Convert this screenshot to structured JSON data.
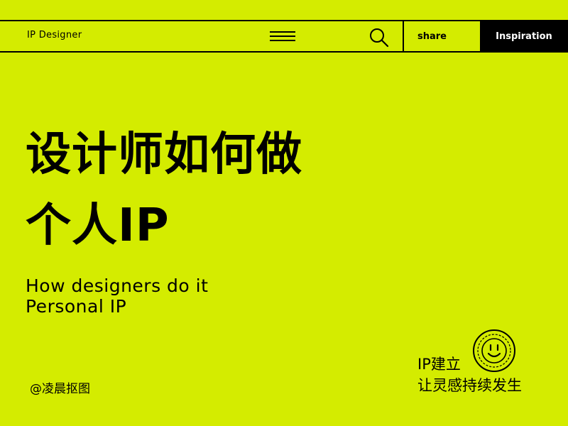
{
  "header": {
    "brand": "IP Designer",
    "share_label": "share",
    "inspiration_label": "Inspiration"
  },
  "title": {
    "line1": "设计师如何做",
    "line2": "个人IP"
  },
  "subtitle": {
    "line1": "How designers do it",
    "line2": "Personal IP"
  },
  "credit": "@凌晨抠图",
  "tagline": {
    "line1": "IP建立",
    "line2": "让灵感持续发生"
  },
  "colors": {
    "background": "#d4ec00",
    "ink": "#000000",
    "accent_text": "#ffffff",
    "badge_ring": "#000000"
  },
  "icons": {
    "menu": "menu-icon",
    "search": "search-icon",
    "badge": "smiley-badge-icon"
  }
}
